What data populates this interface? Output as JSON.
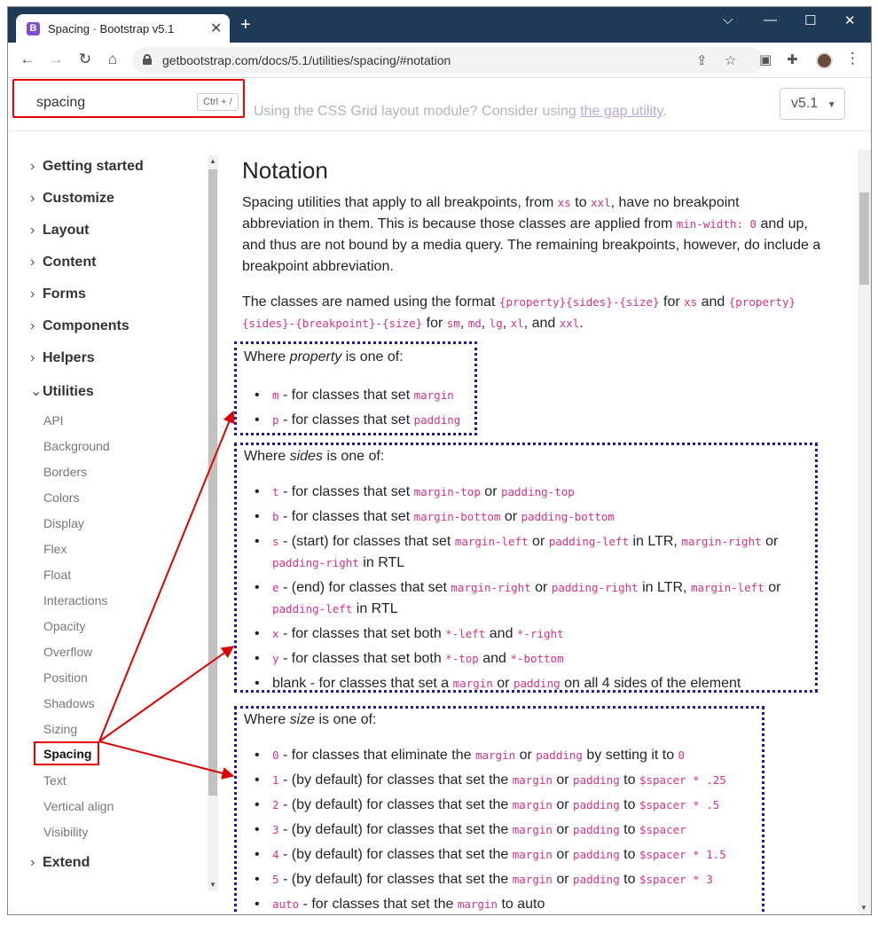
{
  "browser": {
    "tab_title": "Spacing · Bootstrap v5.1",
    "favicon_letter": "B",
    "url": "getbootstrap.com/docs/5.1/utilities/spacing/#notation",
    "new_tab": "+",
    "close": "✕"
  },
  "header": {
    "search_value": "spacing",
    "search_shortcut": "Ctrl + /",
    "ghost_text_pre": "Using the CSS Grid layout module? Consider using ",
    "ghost_link": "the gap utility",
    "ghost_text_post": ".",
    "version": "v5.1"
  },
  "sidebar": {
    "groups": [
      {
        "label": "Getting started"
      },
      {
        "label": "Customize"
      },
      {
        "label": "Layout"
      },
      {
        "label": "Content"
      },
      {
        "label": "Forms"
      },
      {
        "label": "Components"
      },
      {
        "label": "Helpers"
      },
      {
        "label": "Utilities"
      }
    ],
    "items": [
      "API",
      "Background",
      "Borders",
      "Colors",
      "Display",
      "Flex",
      "Float",
      "Interactions",
      "Opacity",
      "Overflow",
      "Position",
      "Shadows",
      "Sizing",
      "Spacing",
      "Text",
      "Vertical align",
      "Visibility"
    ],
    "extend": "Extend"
  },
  "main": {
    "title": "Notation",
    "p1": {
      "t1": "Spacing utilities that apply to all breakpoints, from ",
      "c1": "xs",
      "t2": " to ",
      "c2": "xxl",
      "t3": ", have no breakpoint",
      "line2a": "abbreviation in them. This is because those classes are applied from ",
      "c3": "min-width: 0",
      "line2b": " and up,",
      "line3": "and thus are not bound by a media query. The remaining breakpoints, however, do include a",
      "line4": "breakpoint abbreviation."
    },
    "p2": {
      "t1": "The classes are named using the format ",
      "c1": "{property}{sides}-{size}",
      "t2": " for ",
      "c2": "xs",
      "t3": " and ",
      "c3": "{property}",
      "c4": "{sides}-{breakpoint}-{size}",
      "t4": " for ",
      "c5": "sm",
      "c6": "md",
      "c7": "lg",
      "c8": "xl",
      "t5": ", and ",
      "c9": "xxl",
      "comma": ", ",
      "dot": "."
    },
    "property": {
      "head_a": "Where ",
      "head_em": "property",
      "head_b": " is one of:",
      "items": [
        {
          "code": "m",
          "text": " - for classes that set ",
          "code2": "margin"
        },
        {
          "code": "p",
          "text": " - for classes that set ",
          "code2": "padding"
        }
      ]
    },
    "sides": {
      "head_a": "Where ",
      "head_em": "sides",
      "head_b": " is one of:",
      "t": {
        "code": "t",
        "text": " - for classes that set ",
        "c2": "margin-top",
        "or": " or ",
        "c3": "padding-top"
      },
      "b": {
        "code": "b",
        "text": " - for classes that set ",
        "c2": "margin-bottom",
        "or": " or ",
        "c3": "padding-bottom"
      },
      "s": {
        "code": "s",
        "text": " - (start) for classes that set ",
        "c2": "margin-left",
        "or": " or ",
        "c3": "padding-left",
        "ltr": " in LTR, ",
        "c4": "margin-right",
        "or2": " or",
        "c5": "padding-right",
        "rtl": " in RTL"
      },
      "e": {
        "code": "e",
        "text": " - (end) for classes that set ",
        "c2": "margin-right",
        "or": " or ",
        "c3": "padding-right",
        "ltr": " in LTR, ",
        "c4": "margin-left",
        "or2": " or",
        "c5": "padding-left",
        "rtl": " in RTL"
      },
      "x": {
        "code": "x",
        "text": " - for classes that set both ",
        "c2": "*-left",
        "and": " and ",
        "c3": "*-right"
      },
      "y": {
        "code": "y",
        "text": " - for classes that set both ",
        "c2": "*-top",
        "and": " and ",
        "c3": "*-bottom"
      },
      "blank": {
        "text": "blank - for classes that set a ",
        "c2": "margin",
        "or": " or ",
        "c3": "padding",
        "tail": " on all 4 sides of the element"
      }
    },
    "size": {
      "head_a": "Where ",
      "head_em": "size",
      "head_b": " is one of:",
      "zero": {
        "code": "0",
        "text": " - for classes that eliminate the ",
        "c2": "margin",
        "or": " or ",
        "c3": "padding",
        "tail": " by setting it to ",
        "c4": "0"
      },
      "common": {
        "text": " - (by default) for classes that set the ",
        "c2": "margin",
        "or": " or ",
        "c3": "padding",
        "to": " to "
      },
      "rows": [
        {
          "code": "1",
          "val": "$spacer * .25"
        },
        {
          "code": "2",
          "val": "$spacer * .5"
        },
        {
          "code": "3",
          "val": "$spacer"
        },
        {
          "code": "4",
          "val": "$spacer * 1.5"
        },
        {
          "code": "5",
          "val": "$spacer * 3"
        }
      ],
      "auto": {
        "code": "auto",
        "text": " - for classes that set the ",
        "c2": "margin",
        "tail": " to auto"
      }
    }
  },
  "colors": {
    "annotation_red": "#e00000",
    "annotation_blue": "#1a1aa8",
    "code_pink": "#d63384"
  }
}
